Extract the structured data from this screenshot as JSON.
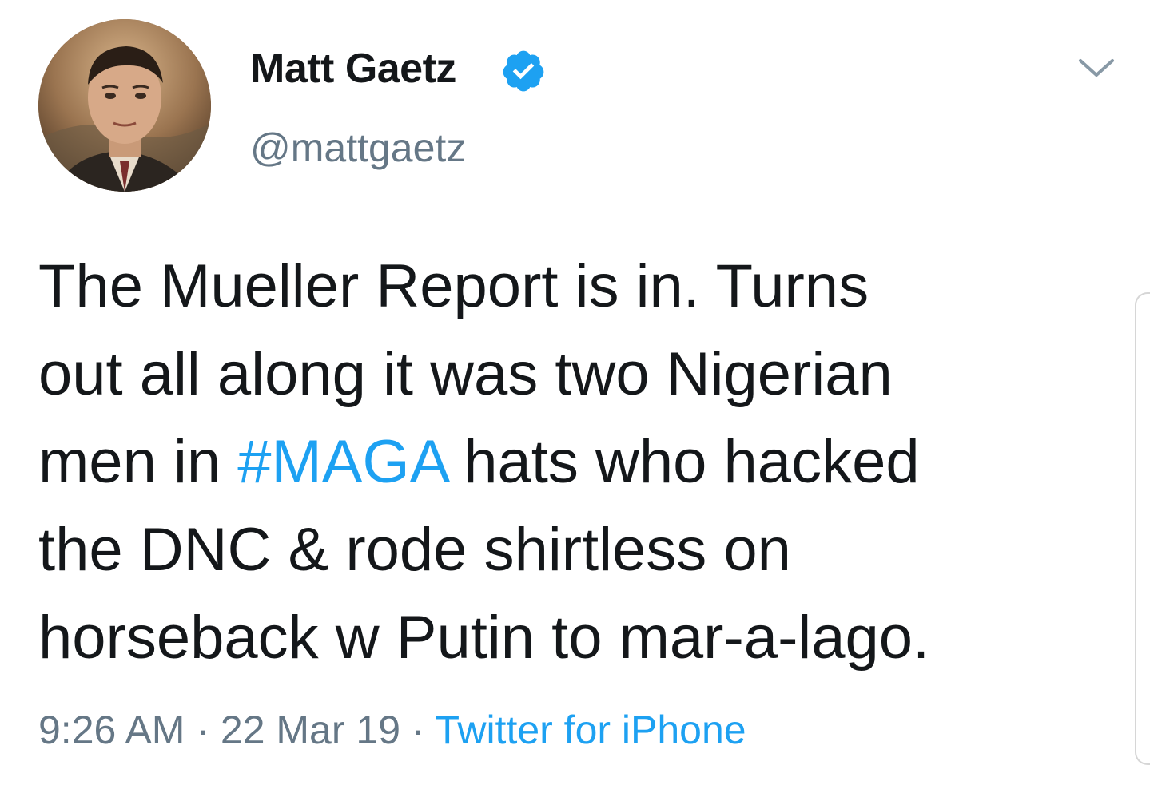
{
  "author": {
    "display_name": "Matt Gaetz",
    "handle": "@mattgaetz",
    "verified": true,
    "avatar_icon": "profile-photo-avatar"
  },
  "tweet": {
    "line1": "The Mueller Report is in. Turns",
    "line2": "out all along it was two Nigerian",
    "line3_before": "men in ",
    "hashtag": "#MAGA",
    "line3_after": " hats who hacked",
    "line4": "the DNC & rode shirtless on",
    "line5": "horseback w Putin to mar-a-lago."
  },
  "meta": {
    "time": "9:26 AM",
    "sep1": " · ",
    "date": "22 Mar 19",
    "sep2": " · ",
    "source": "Twitter for iPhone"
  },
  "colors": {
    "accent": "#1da1f2",
    "text": "#14171a",
    "muted": "#657786"
  },
  "icons": {
    "verified": "verified-badge-icon",
    "menu": "chevron-down-icon"
  }
}
